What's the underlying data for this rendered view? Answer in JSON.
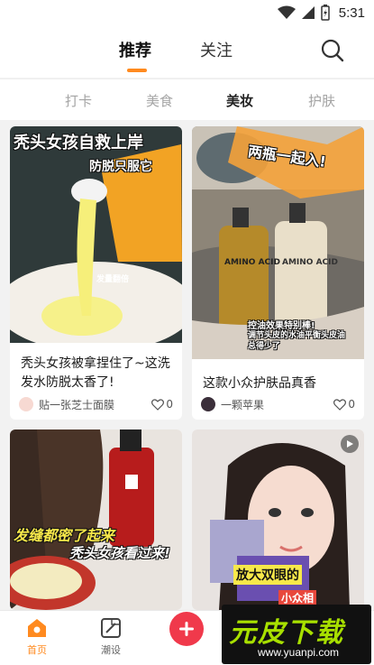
{
  "status_bar": {
    "time": "5:31"
  },
  "top_nav": {
    "tabs": [
      {
        "label": "推荐",
        "active": true
      },
      {
        "label": "关注",
        "active": false
      }
    ],
    "search_icon": "search-icon"
  },
  "sub_tabs": [
    {
      "label": "打卡",
      "active": false
    },
    {
      "label": "美食",
      "active": false
    },
    {
      "label": "美妆",
      "active": true
    },
    {
      "label": "护肤",
      "active": false
    }
  ],
  "feed": [
    {
      "image_overlay": [
        "秃头女孩自救上岸",
        "防脱只服它",
        "发量翻倍"
      ],
      "title": "秃头女孩被拿捏住了~这洗发水防脱太香了!",
      "author": "贴一张芝士面膜",
      "likes": "0"
    },
    {
      "image_overlay": [
        "两瓶一起入!",
        "AMINO ACID",
        "AMINO ACID",
        "控油效果特别棒!",
        "调节头皮的水油平衡头皮油",
        "总得少了"
      ],
      "title": "这款小众护肤品真香",
      "author": "一颗苹果",
      "likes": "0"
    },
    {
      "image_overlay": [
        "发缝都密了起来",
        "秃头女孩看过来!"
      ],
      "title": "",
      "author": "",
      "likes": ""
    },
    {
      "image_overlay": [
        "放大双眼的",
        "小众相"
      ],
      "title": "",
      "author": "",
      "likes": "",
      "is_video": true
    }
  ],
  "bottom_nav": [
    {
      "label": "首页",
      "active": true,
      "icon": "home-icon"
    },
    {
      "label": "潮设",
      "active": false,
      "icon": "edit-icon"
    }
  ],
  "fab_icon": "plus-icon",
  "watermark": {
    "main": "元皮下载",
    "url": "www.yuanpi.com"
  },
  "colors": {
    "accent": "#ff8a1f",
    "fab": "#f0394b"
  }
}
